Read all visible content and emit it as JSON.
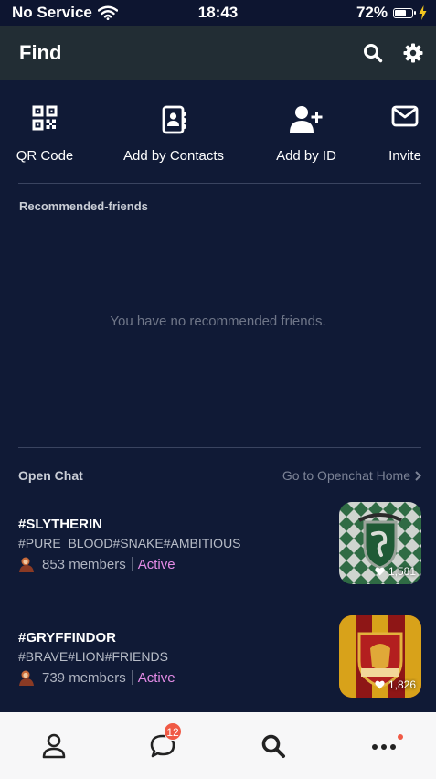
{
  "status_bar": {
    "carrier": "No Service",
    "time": "18:43",
    "battery_pct": "72%",
    "battery_level": 0.72
  },
  "header": {
    "title": "Find",
    "icons": [
      "search-icon",
      "gear-icon"
    ]
  },
  "actions": [
    {
      "label": "QR Code",
      "icon": "qr-code-icon"
    },
    {
      "label": "Add by Contacts",
      "icon": "contacts-book-icon"
    },
    {
      "label": "Add by ID",
      "icon": "add-user-icon"
    },
    {
      "label": "Invite",
      "icon": "envelope-icon"
    }
  ],
  "recommended": {
    "title": "Recommended-friends",
    "empty_message": "You have no recommended friends."
  },
  "open_chat": {
    "title": "Open Chat",
    "link": "Go to Openchat Home",
    "items": [
      {
        "name": "#SLYTHERIN",
        "tags": "#PURE_BLOOD#SNAKE#AMBITIOUS",
        "members": "853 members",
        "status": "Active",
        "likes": "1,581"
      },
      {
        "name": "#GRYFFINDOR",
        "tags": "#BRAVE#LION#FRIENDS",
        "members": "739 members",
        "status": "Active",
        "likes": "1,826"
      }
    ]
  },
  "tabbar": {
    "chats_badge": "12",
    "items": [
      "friends-icon",
      "chats-icon",
      "search-icon",
      "more-icon"
    ]
  },
  "colors": {
    "background": "#101a36",
    "header": "#222d34",
    "active": "#e48be6",
    "badge": "#f05a46",
    "tabbar": "#f7f7f8"
  }
}
